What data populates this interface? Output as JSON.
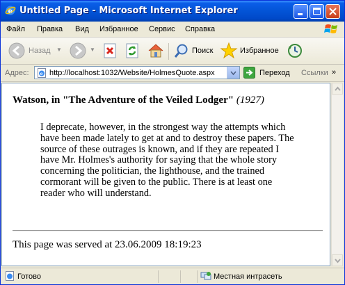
{
  "window": {
    "title": "Untitled Page - Microsoft Internet Explorer"
  },
  "menu": {
    "items": [
      "Файл",
      "Правка",
      "Вид",
      "Избранное",
      "Сервис",
      "Справка"
    ]
  },
  "toolbar": {
    "back_label": "Назад",
    "search_label": "Поиск",
    "favorites_label": "Избранное"
  },
  "address": {
    "label": "Адрес:",
    "url": "http://localhost:1032/Website/HolmesQuote.aspx",
    "go_label": "Переход",
    "links_label": "Ссылки",
    "links_chevron": "»"
  },
  "page": {
    "quote_heading": "Watson, in \"The Adventure of the Veiled Lodger\" ",
    "quote_year": "(1927)",
    "quote_text": "I deprecate, however, in the strongest way the attempts which have been made lately to get at and to destroy these papers. The source of these outrages is known, and if they are repeated I have Mr. Holmes's authority for saying that the whole story concerning the politician, the lighthouse, and the trained cormorant will be given to the public. There is at least one reader who will understand.",
    "served_text": "This page was served at 23.06.2009 18:19:23"
  },
  "status": {
    "text": "Готово",
    "zone": "Местная интрасеть"
  },
  "colors": {
    "titlebar": "#0354d6",
    "chrome": "#ece9d8",
    "content_bg": "#ffffff"
  }
}
